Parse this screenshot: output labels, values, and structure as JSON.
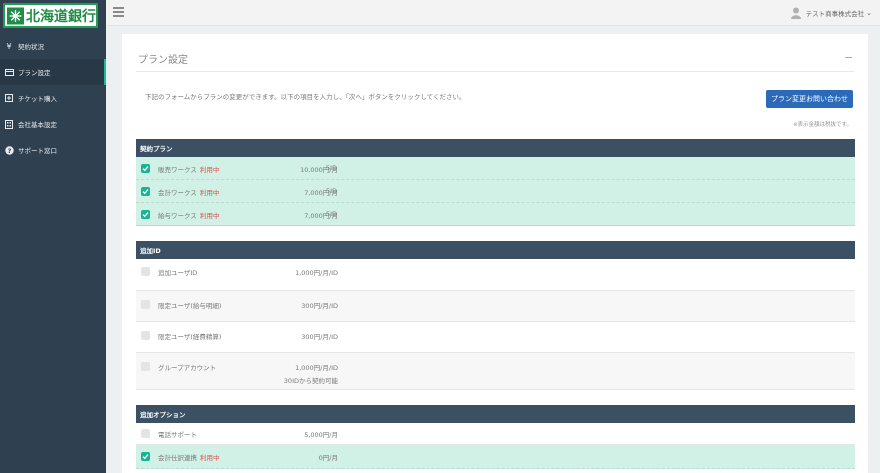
{
  "logo": {
    "text": "北海道銀行"
  },
  "sidebar": {
    "items": [
      {
        "icon": "yen-icon",
        "glyph": "¥",
        "label": "契約状況",
        "active": false
      },
      {
        "icon": "card-icon",
        "glyph": "▭",
        "label": "プラン設定",
        "active": true
      },
      {
        "icon": "plus-square-icon",
        "glyph": "⊞",
        "label": "チケット購入",
        "active": false
      },
      {
        "icon": "building-icon",
        "glyph": "▦",
        "label": "会社基本設定",
        "active": false
      },
      {
        "icon": "help-circle-icon",
        "glyph": "?",
        "label": "サポート窓口",
        "active": false
      }
    ]
  },
  "header": {
    "user_name": "テスト商事株式会社",
    "caret": "⌄"
  },
  "panel": {
    "title": "プラン設定",
    "instruction": "下記のフォームからプランの変更ができます。以下の項目を入力し、「次へ」ボタンをクリックしてください。",
    "contact_button": "プラン変更お問い合わせ",
    "note": "※表示金額は税抜です。"
  },
  "sections": [
    {
      "title": "契約プラン",
      "rows": [
        {
          "checked": true,
          "name": "販売ワークス",
          "status": "利用中",
          "price": "10,000円/月",
          "count": "5ID"
        },
        {
          "checked": true,
          "name": "会計ワークス",
          "status": "利用中",
          "price": "7,000円/月",
          "count": "5ID"
        },
        {
          "checked": true,
          "name": "給与ワークス",
          "status": "利用中",
          "price": "7,000円/月",
          "count": "5ID"
        }
      ]
    },
    {
      "title": "追加ID",
      "rows": [
        {
          "checked": false,
          "name": "追加ユーザID",
          "price": "1,000円/月/ID"
        },
        {
          "checked": false,
          "name": "限定ユーザ(給与明細)",
          "price": "300円/月/ID"
        },
        {
          "checked": false,
          "name": "限定ユーザ(経費精算)",
          "price": "300円/月/ID"
        },
        {
          "checked": false,
          "name": "グループアカウント",
          "price": "1,000円/月/ID",
          "sub": "30IDから契約可能"
        }
      ]
    },
    {
      "title": "追加オプション",
      "rows": [
        {
          "checked": false,
          "name": "電話サポート",
          "price": "5,000円/月"
        },
        {
          "checked": true,
          "name": "会計仕訳連携",
          "status": "利用中",
          "price": "0円/月"
        }
      ]
    }
  ],
  "colors": {
    "sidebar": "#2f4050",
    "accent": "#1ab394",
    "section_header": "#3b5063",
    "selected_row": "#d1f0e6",
    "button": "#2a6ab8",
    "status": "#d9534f",
    "logo_green": "#1e8e47"
  }
}
